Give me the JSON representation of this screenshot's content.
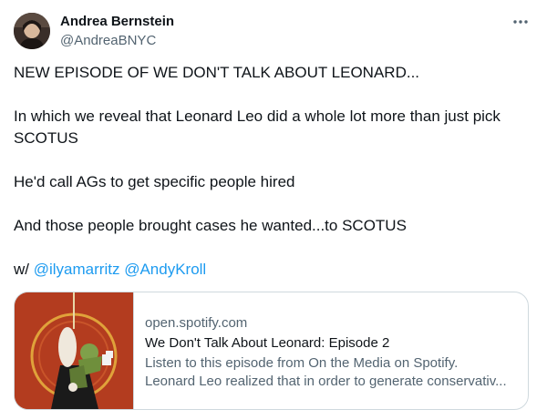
{
  "author": {
    "name": "Andrea Bernstein",
    "handle": "@AndreaBNYC"
  },
  "tweet": {
    "line1": "NEW EPISODE OF WE DON'T TALK ABOUT LEONARD...",
    "line2a": "In which we reveal that Leonard Leo did a whole lot more than just pick",
    "line2b": "SCOTUS",
    "line3": "He'd call AGs to get specific people hired",
    "line4": "And those people brought cases he wanted...to SCOTUS",
    "with_prefix": "w/",
    "mentions": [
      "@ilyamarritz",
      "@AndyKroll"
    ]
  },
  "card": {
    "domain": "open.spotify.com",
    "title": "We Don't Talk About Leonard: Episode 2",
    "desc_line1": "Listen to this episode from On the Media on Spotify.",
    "desc_line2": "Leonard Leo realized that in order to generate conservativ..."
  },
  "colors": {
    "text": "#0f1419",
    "secondary": "#536471",
    "link": "#1d9bf0",
    "border": "#cfd9de",
    "thumb_red": "#b33c1f"
  },
  "icons": {
    "more": "more-horizontal-icon"
  }
}
